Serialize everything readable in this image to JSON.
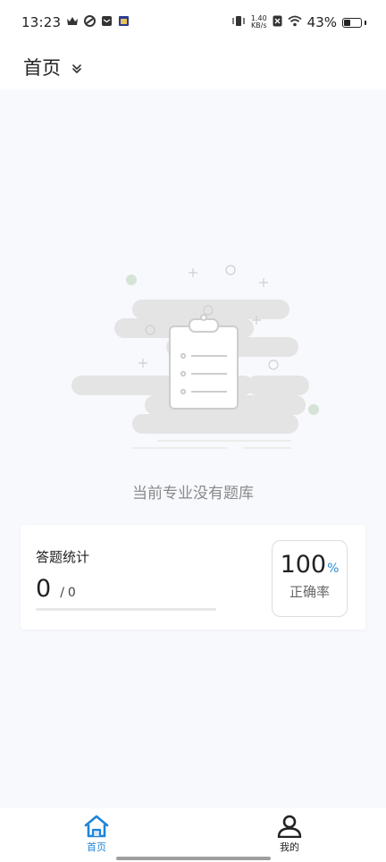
{
  "status_bar": {
    "time": "13:23",
    "speed_value": "1.40",
    "speed_unit": "KB/s",
    "battery_percent": "43%",
    "battery_level": 0.43,
    "icons": [
      "crown-icon",
      "app-icon",
      "message-icon",
      "calendar-icon",
      "vibrate-icon",
      "no-sim-icon",
      "wifi-icon",
      "battery-icon"
    ]
  },
  "header": {
    "title": "首页",
    "dropdown_icon": "double-chevron-down-icon"
  },
  "empty_state": {
    "message": "当前专业没有题库",
    "illustration_icon": "clipboard-icon"
  },
  "stats_card": {
    "title": "答题统计",
    "answered": "0",
    "separator": "/",
    "total": "0",
    "progress": 0,
    "accuracy_value": "100",
    "accuracy_unit": "%",
    "accuracy_label": "正确率"
  },
  "tabbar": {
    "tabs": [
      {
        "label": "首页",
        "icon": "home-icon",
        "active": true
      },
      {
        "label": "我的",
        "icon": "user-icon",
        "active": false
      }
    ]
  },
  "colors": {
    "accent": "#1f84d8",
    "page_background": "#f7f9fd"
  }
}
